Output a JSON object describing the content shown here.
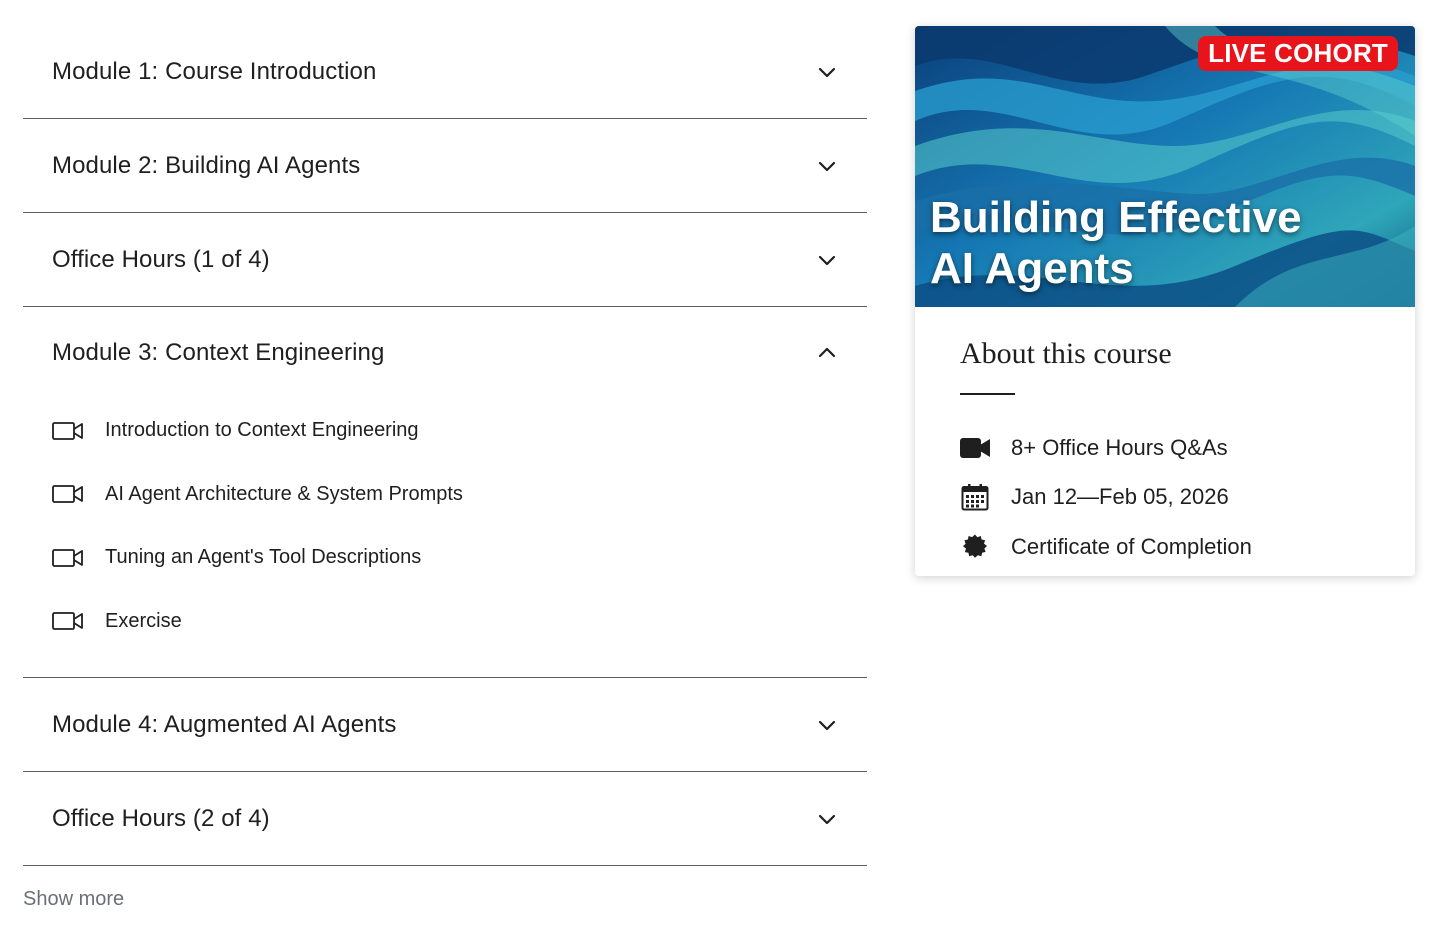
{
  "modules": [
    {
      "title": "Module 1: Course Introduction",
      "expanded": false
    },
    {
      "title": "Module 2: Building AI Agents",
      "expanded": false
    },
    {
      "title": "Office Hours (1 of 4)",
      "expanded": false
    },
    {
      "title": "Module 3: Context Engineering",
      "expanded": true,
      "lessons": [
        {
          "label": "Introduction to Context Engineering",
          "icon": "video-icon"
        },
        {
          "label": "AI Agent Architecture & System Prompts",
          "icon": "video-icon"
        },
        {
          "label": "Tuning an Agent's Tool Descriptions",
          "icon": "video-icon"
        },
        {
          "label": "Exercise",
          "icon": "video-icon"
        }
      ]
    },
    {
      "title": "Module 4: Augmented AI Agents",
      "expanded": false
    },
    {
      "title": "Office Hours (2 of 4)",
      "expanded": false
    }
  ],
  "show_more": "Show more",
  "card": {
    "badge": "LIVE COHORT",
    "banner_title_line1": "Building Effective",
    "banner_title_line2": "AI Agents",
    "about_heading": "About this course",
    "features": [
      {
        "icon": "video-camera-icon",
        "label": "8+ Office Hours Q&As"
      },
      {
        "icon": "calendar-icon",
        "label": "Jan 12—Feb 05, 2026"
      },
      {
        "icon": "certificate-badge-icon",
        "label": "Certificate of Completion"
      }
    ]
  },
  "colors": {
    "badge": "#e8141c",
    "divider": "#5f5f5f",
    "muted_text": "#6b6f76",
    "banner_deep": "#0b3f7a",
    "banner_light": "#52c4c9"
  }
}
